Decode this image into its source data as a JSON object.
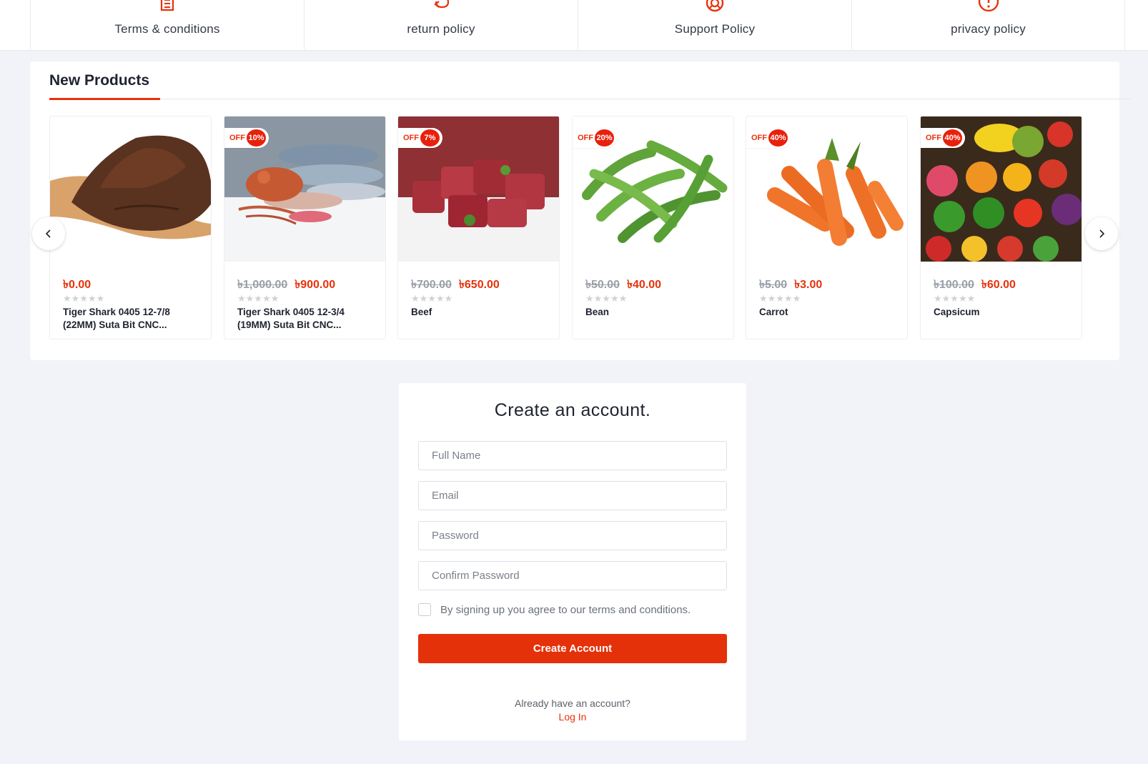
{
  "policies": [
    {
      "label": "Terms & conditions",
      "icon": "document-icon"
    },
    {
      "label": "return policy",
      "icon": "return-arrow-icon"
    },
    {
      "label": "Support Policy",
      "icon": "lifebuoy-icon"
    },
    {
      "label": "privacy policy",
      "icon": "alert-circle-icon"
    }
  ],
  "new_products": {
    "title": "New Products",
    "off_label": "OFF",
    "stars": "★★★★★",
    "items": [
      {
        "name": "Tiger Shark 0405 12-7/8 (22MM) Suta Bit CNC...",
        "old_price": "",
        "price": "৳0.00",
        "discount": "",
        "image": "coffee-powder-on-spoon"
      },
      {
        "name": "Tiger Shark 0405 12-3/4 (19MM) Suta Bit CNC...",
        "old_price": "৳1,000.00",
        "price": "৳900.00",
        "discount": "10%",
        "image": "seafood-assortment"
      },
      {
        "name": "Beef",
        "old_price": "৳700.00",
        "price": "৳650.00",
        "discount": "7%",
        "image": "beef-cubes"
      },
      {
        "name": "Bean",
        "old_price": "৳50.00",
        "price": "৳40.00",
        "discount": "20%",
        "image": "green-beans"
      },
      {
        "name": "Carrot",
        "old_price": "৳5.00",
        "price": "৳3.00",
        "discount": "40%",
        "image": "carrots"
      },
      {
        "name": "Capsicum",
        "old_price": "৳100.00",
        "price": "৳60.00",
        "discount": "40%",
        "image": "mixed-vegetables"
      }
    ]
  },
  "signup": {
    "title": "Create an account.",
    "full_name_placeholder": "Full Name",
    "email_placeholder": "Email",
    "password_placeholder": "Password",
    "confirm_password_placeholder": "Confirm Password",
    "agree_text": "By signing up you agree to our terms and conditions.",
    "submit_label": "Create Account",
    "already_text": "Already have an account?",
    "login_label": "Log In"
  },
  "colors": {
    "accent": "#e8320c",
    "page_background": "#f1f3f8"
  }
}
